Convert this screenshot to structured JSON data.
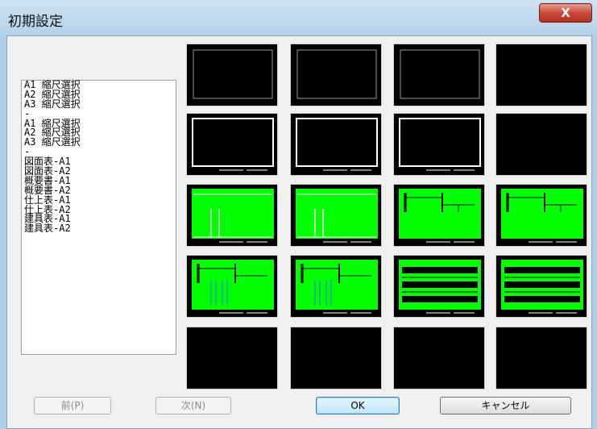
{
  "window": {
    "title": "初期設定",
    "close_label": "X"
  },
  "list": {
    "items": [
      "A1 縮尺選択",
      "A2 縮尺選択",
      "A3 縮尺選択",
      "-",
      "A1 縮尺選択",
      "A2 縮尺選択",
      "A3 縮尺選択",
      "-",
      "図面表-A1",
      "図面表-A2",
      "概要書-A1",
      "概要書-A2",
      "仕上表-A1",
      "仕上表-A2",
      "建具表-A1",
      "建具表-A2"
    ]
  },
  "thumbnails": {
    "rows": [
      [
        "frame-thin",
        "frame-thin",
        "frame-thin",
        "blank"
      ],
      [
        "frame-white",
        "frame-white",
        "frame-white",
        "blank"
      ],
      [
        "green-plan",
        "green-plan",
        "green-summary",
        "green-summary"
      ],
      [
        "green-finish",
        "green-finish",
        "green-fittings",
        "green-fittings"
      ],
      [
        "blank",
        "blank",
        "blank",
        "blank"
      ]
    ],
    "colors": {
      "bg": "#000000",
      "green": "#00ff00",
      "white": "#ffffff"
    }
  },
  "buttons": {
    "prev": "前(P)",
    "next": "次(N)",
    "ok": "OK",
    "cancel": "キャンセル"
  }
}
